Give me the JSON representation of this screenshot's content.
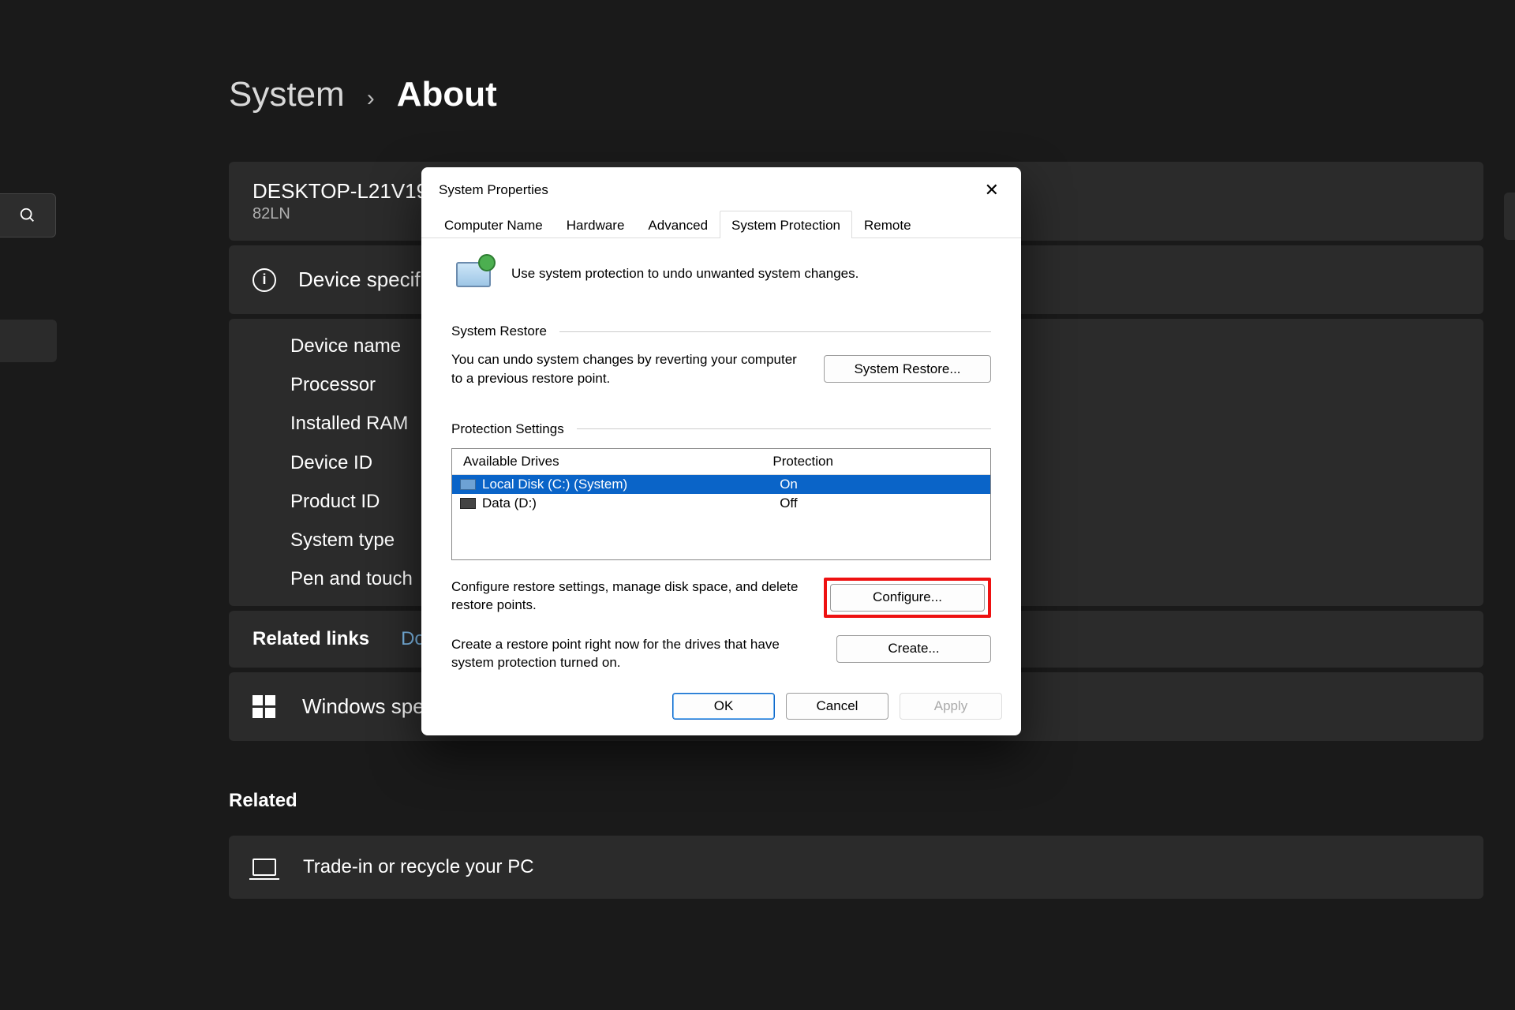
{
  "breadcrumb": {
    "system": "System",
    "about": "About"
  },
  "header_card": {
    "name": "DESKTOP-L21V19S",
    "model": "82LN"
  },
  "device_spec_title": "Device specifications",
  "spec_labels": {
    "device_name": "Device name",
    "processor": "Processor",
    "ram": "Installed RAM",
    "device_id": "Device ID",
    "product_id": "Product ID",
    "system_type": "System type",
    "pen_touch": "Pen and touch"
  },
  "related_links": {
    "label": "Related links",
    "domain": "Domain"
  },
  "windows_spec_title": "Windows specifications",
  "related_heading": "Related",
  "tradein": "Trade-in or recycle your PC",
  "dialog": {
    "title": "System Properties",
    "tabs": {
      "computer_name": "Computer Name",
      "hardware": "Hardware",
      "advanced": "Advanced",
      "system_protection": "System Protection",
      "remote": "Remote"
    },
    "intro": "Use system protection to undo unwanted system changes.",
    "system_restore_label": "System Restore",
    "restore_desc": "You can undo system changes by reverting your computer to a previous restore point.",
    "system_restore_btn": "System Restore...",
    "protection_settings_label": "Protection Settings",
    "col_drives": "Available Drives",
    "col_protection": "Protection",
    "drives": [
      {
        "name": "Local Disk (C:) (System)",
        "protection": "On",
        "selected": true,
        "icon": "system"
      },
      {
        "name": "Data (D:)",
        "protection": "Off",
        "selected": false,
        "icon": "data"
      }
    ],
    "configure_desc": "Configure restore settings, manage disk space, and delete restore points.",
    "configure_btn": "Configure...",
    "create_desc": "Create a restore point right now for the drives that have system protection turned on.",
    "create_btn": "Create...",
    "ok": "OK",
    "cancel": "Cancel",
    "apply": "Apply"
  }
}
